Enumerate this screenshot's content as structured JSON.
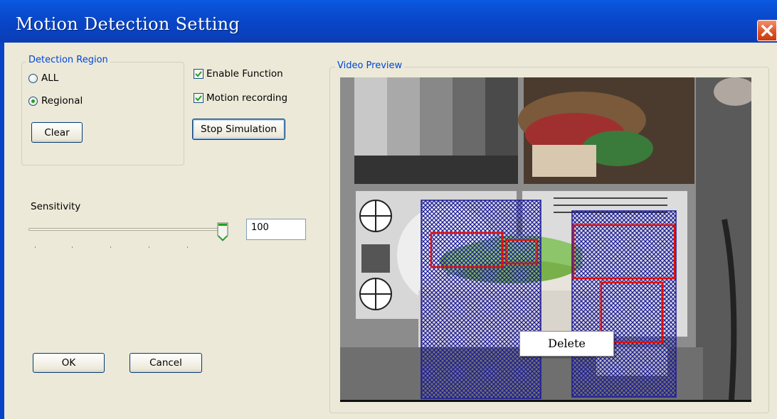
{
  "window": {
    "title": "Motion Detection Setting"
  },
  "detection_region": {
    "legend": "Detection Region",
    "options": [
      {
        "label": "ALL",
        "selected": false
      },
      {
        "label": "Regional",
        "selected": true
      }
    ],
    "clear_label": "Clear"
  },
  "options": {
    "enable_function": {
      "label": "Enable Function",
      "checked": true
    },
    "motion_recording": {
      "label": "Motion recording",
      "checked": true
    },
    "stop_simulation_label": "Stop Simulation"
  },
  "sensitivity": {
    "label": "Sensitivity",
    "value": "100",
    "slider_level": 1.0
  },
  "dialog_buttons": {
    "ok_label": "OK",
    "cancel_label": "Cancel"
  },
  "video_preview": {
    "legend": "Video Preview"
  },
  "context_menu": {
    "delete_label": "Delete"
  },
  "colors": {
    "titlebar": "#0845c6",
    "region_fill": "#1a1a9a",
    "motion_box": "#e01010"
  }
}
